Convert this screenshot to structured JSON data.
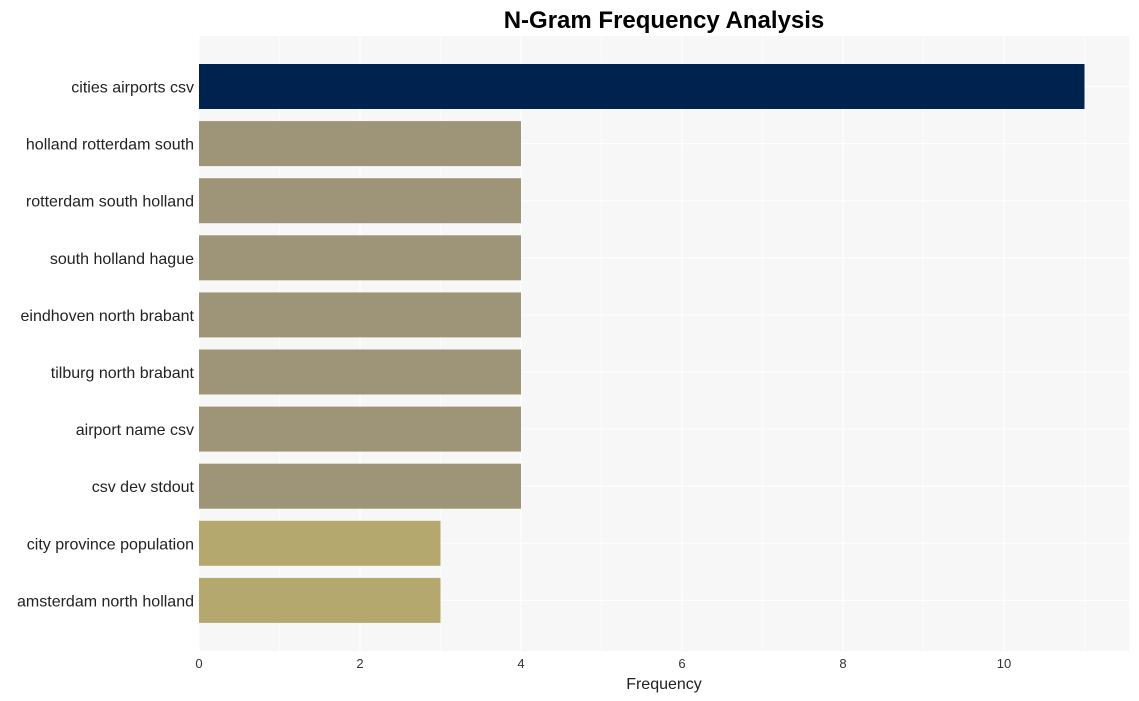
{
  "chart_data": {
    "type": "bar",
    "orientation": "horizontal",
    "title": "N-Gram Frequency Analysis",
    "xlabel": "Frequency",
    "ylabel": "",
    "xlim": [
      0,
      11.5
    ],
    "xticks": [
      0,
      2,
      4,
      6,
      8,
      10
    ],
    "grid": true,
    "categories": [
      "cities airports csv",
      "holland rotterdam south",
      "rotterdam south holland",
      "south holland hague",
      "eindhoven north brabant",
      "tilburg north brabant",
      "airport name csv",
      "csv dev stdout",
      "city province population",
      "amsterdam north holland"
    ],
    "values": [
      11,
      4,
      4,
      4,
      4,
      4,
      4,
      4,
      3,
      3
    ],
    "colors": [
      "#00224e",
      "#9e9478",
      "#9e9478",
      "#9e9478",
      "#9e9478",
      "#9e9478",
      "#9e9478",
      "#9e9478",
      "#b5a86e",
      "#b5a86e"
    ],
    "background": "#f7f7f7",
    "grid_color": "#ffffff"
  }
}
